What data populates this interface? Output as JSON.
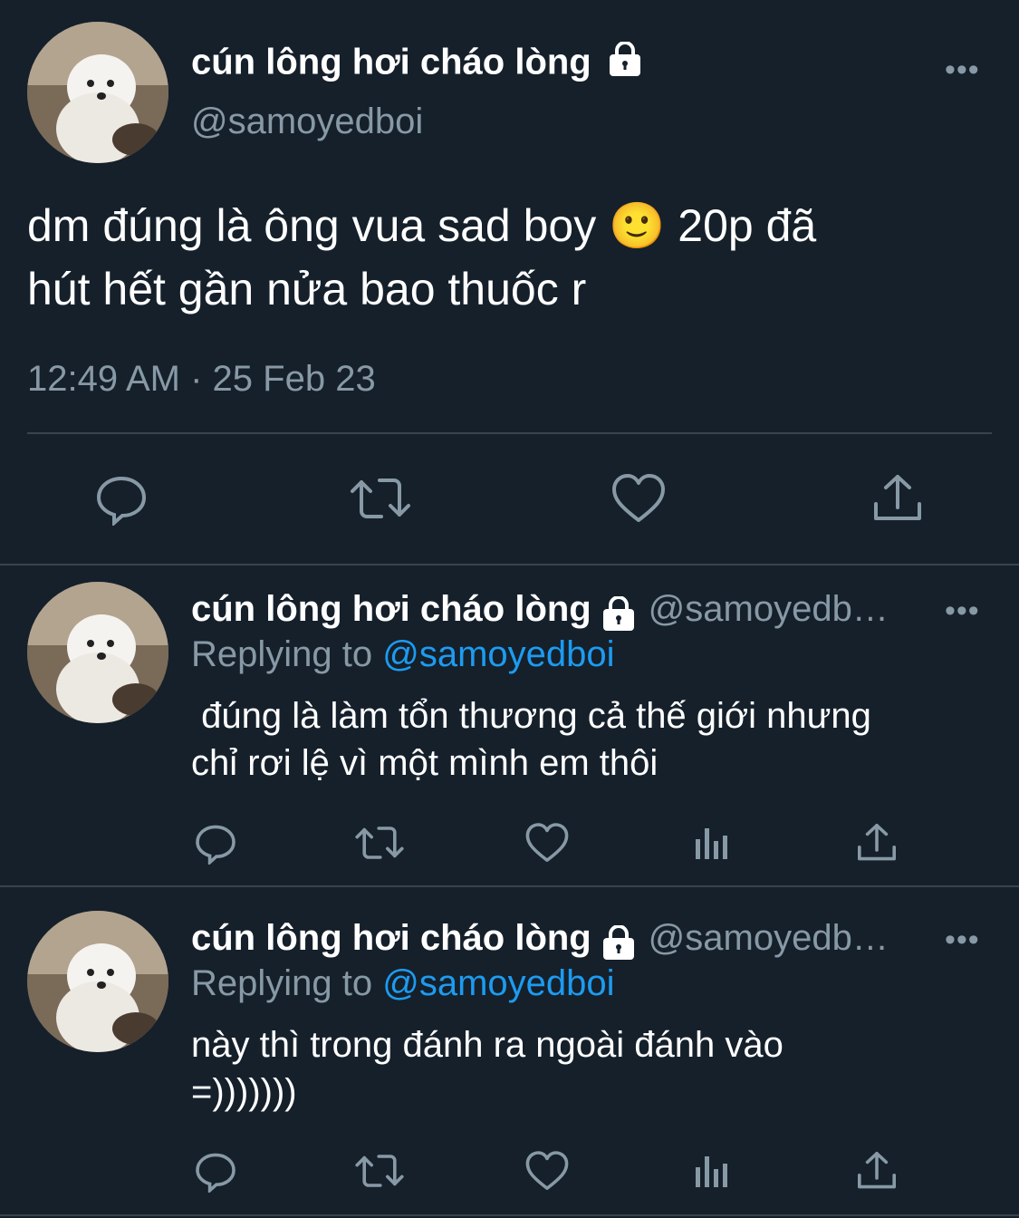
{
  "main_tweet": {
    "display_name": "cún lông hơi cháo lòng",
    "handle": "@samoyedboi",
    "text_line1": "dm đúng là ông vua sad boy 🙂  20p đã",
    "text_line2": "hút hết gần nửa bao thuốc r",
    "timestamp": "12:49 AM · 25 Feb 23",
    "more": "•••"
  },
  "replies": [
    {
      "display_name": "cún lông hơi cháo lòng",
      "handle": "@samoyedb…",
      "replying_prefix": "Replying to",
      "replying_handle": "@samoyedboi",
      "text_line1": " đúng là làm tổn thương cả thế giới nhưng",
      "text_line2": "chỉ rơi lệ vì một mình em thôi",
      "more": "•••"
    },
    {
      "display_name": "cún lông hơi cháo lòng",
      "handle": "@samoyedb…",
      "replying_prefix": "Replying to",
      "replying_handle": "@samoyedboi",
      "text_line1": "này thì trong đánh ra ngoài đánh vào",
      "text_line2": "=)))))))",
      "more": "•••"
    }
  ],
  "icons": [
    "reply-icon",
    "retweet-icon",
    "like-icon",
    "analytics-icon",
    "share-icon",
    "lock-icon",
    "more-icon"
  ],
  "colors": {
    "background": "#15202b",
    "text": "#ffffff",
    "secondary": "#8899a6",
    "link": "#1d9bf0",
    "divider": "#38444d"
  }
}
